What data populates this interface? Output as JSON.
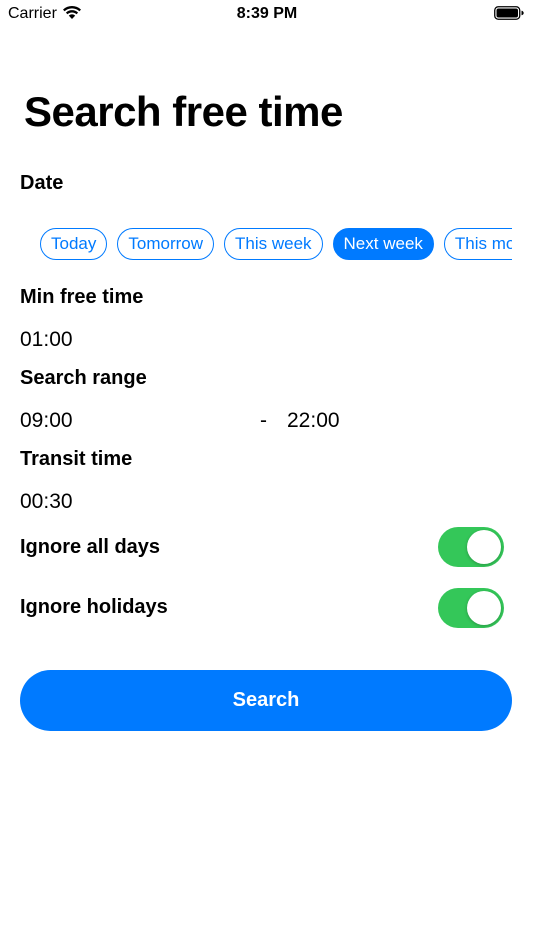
{
  "status_bar": {
    "carrier": "Carrier",
    "time": "8:39 PM"
  },
  "page": {
    "title": "Search free time"
  },
  "date": {
    "label": "Date",
    "chips": [
      {
        "label": "Today",
        "selected": false
      },
      {
        "label": "Tomorrow",
        "selected": false
      },
      {
        "label": "This week",
        "selected": false
      },
      {
        "label": "Next week",
        "selected": true
      },
      {
        "label": "This month",
        "selected": false
      }
    ]
  },
  "min_free_time": {
    "label": "Min free time",
    "value": "01:00"
  },
  "search_range": {
    "label": "Search range",
    "start": "09:00",
    "separator": "-",
    "end": "22:00"
  },
  "transit_time": {
    "label": "Transit time",
    "value": "00:30"
  },
  "ignore_all_days": {
    "label": "Ignore all days",
    "on": true
  },
  "ignore_holidays": {
    "label": "Ignore holidays",
    "on": true
  },
  "search_button": {
    "label": "Search"
  },
  "colors": {
    "accent": "#007aff",
    "toggle_on": "#34c759"
  }
}
